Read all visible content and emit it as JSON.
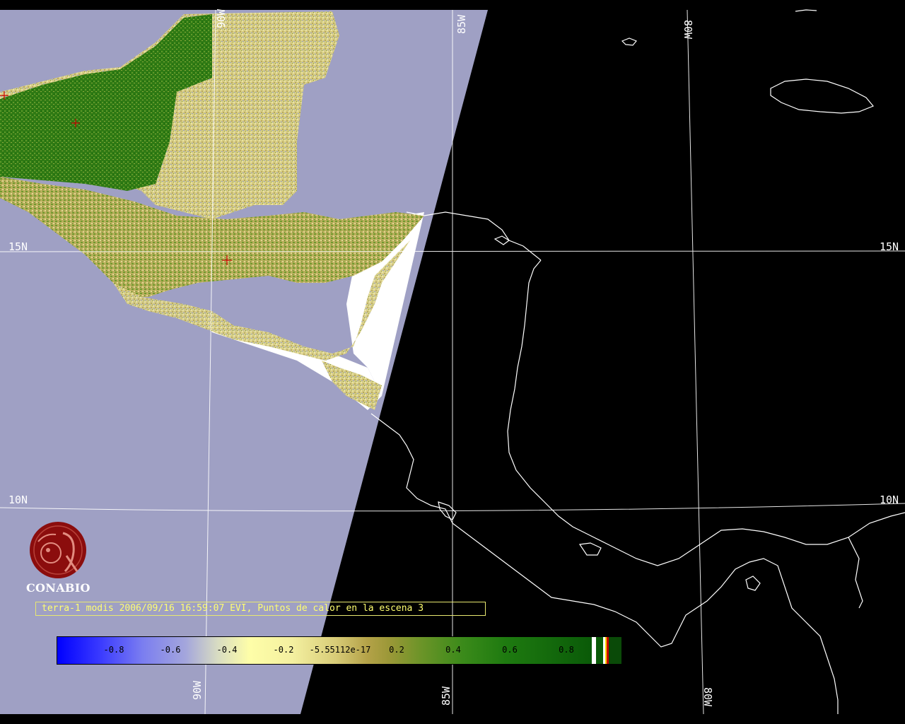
{
  "grid_labels": {
    "lon_90w": "90W",
    "lon_85w": "85W",
    "lon_80w": "80W",
    "lat_15n": "15N",
    "lat_10n": "10N"
  },
  "logo": {
    "text": "CONABIO",
    "icon": "conabio-logo-icon"
  },
  "caption": {
    "text": "terra-1 modis 2006/09/16 16:59:07 EVI, Puntos de calor en la escena 3"
  },
  "colorbar": {
    "labels": [
      "-0.8",
      "-0.6",
      "-0.4",
      "-0.2",
      "-5.55112e-17",
      "0.2",
      "0.4",
      "0.6",
      "0.8"
    ]
  },
  "colors": {
    "no_data_water": "#9fa0c4",
    "outside_swath": "#000000",
    "coastline": "#ffffff",
    "grid": "#ffffff",
    "caption_text": "#ffff70",
    "logo_red": "#8b0d0d",
    "hotspot_marker": "#cc0000"
  }
}
